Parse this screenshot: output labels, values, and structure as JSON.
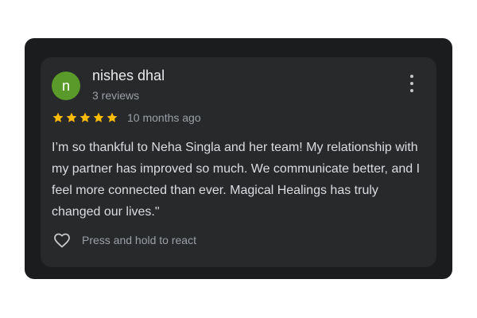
{
  "review": {
    "avatar_initial": "n",
    "author_name": "nishes dhal",
    "author_reviews": "3 reviews",
    "rating": 5,
    "rating_max": 5,
    "star_color": "#fbbc04",
    "avatar_color": "#5a9a2a",
    "time": "10 months ago",
    "text": "I’m so thankful to Neha Singla and her team! My relationship with my partner has improved so much. We communicate better, and I feel more connected than ever. Magical Healings has truly changed our lives.\"",
    "react_label": "Press and hold to react",
    "more_icon": "more-vert-icon",
    "react_icon": "heart-outline-icon"
  }
}
